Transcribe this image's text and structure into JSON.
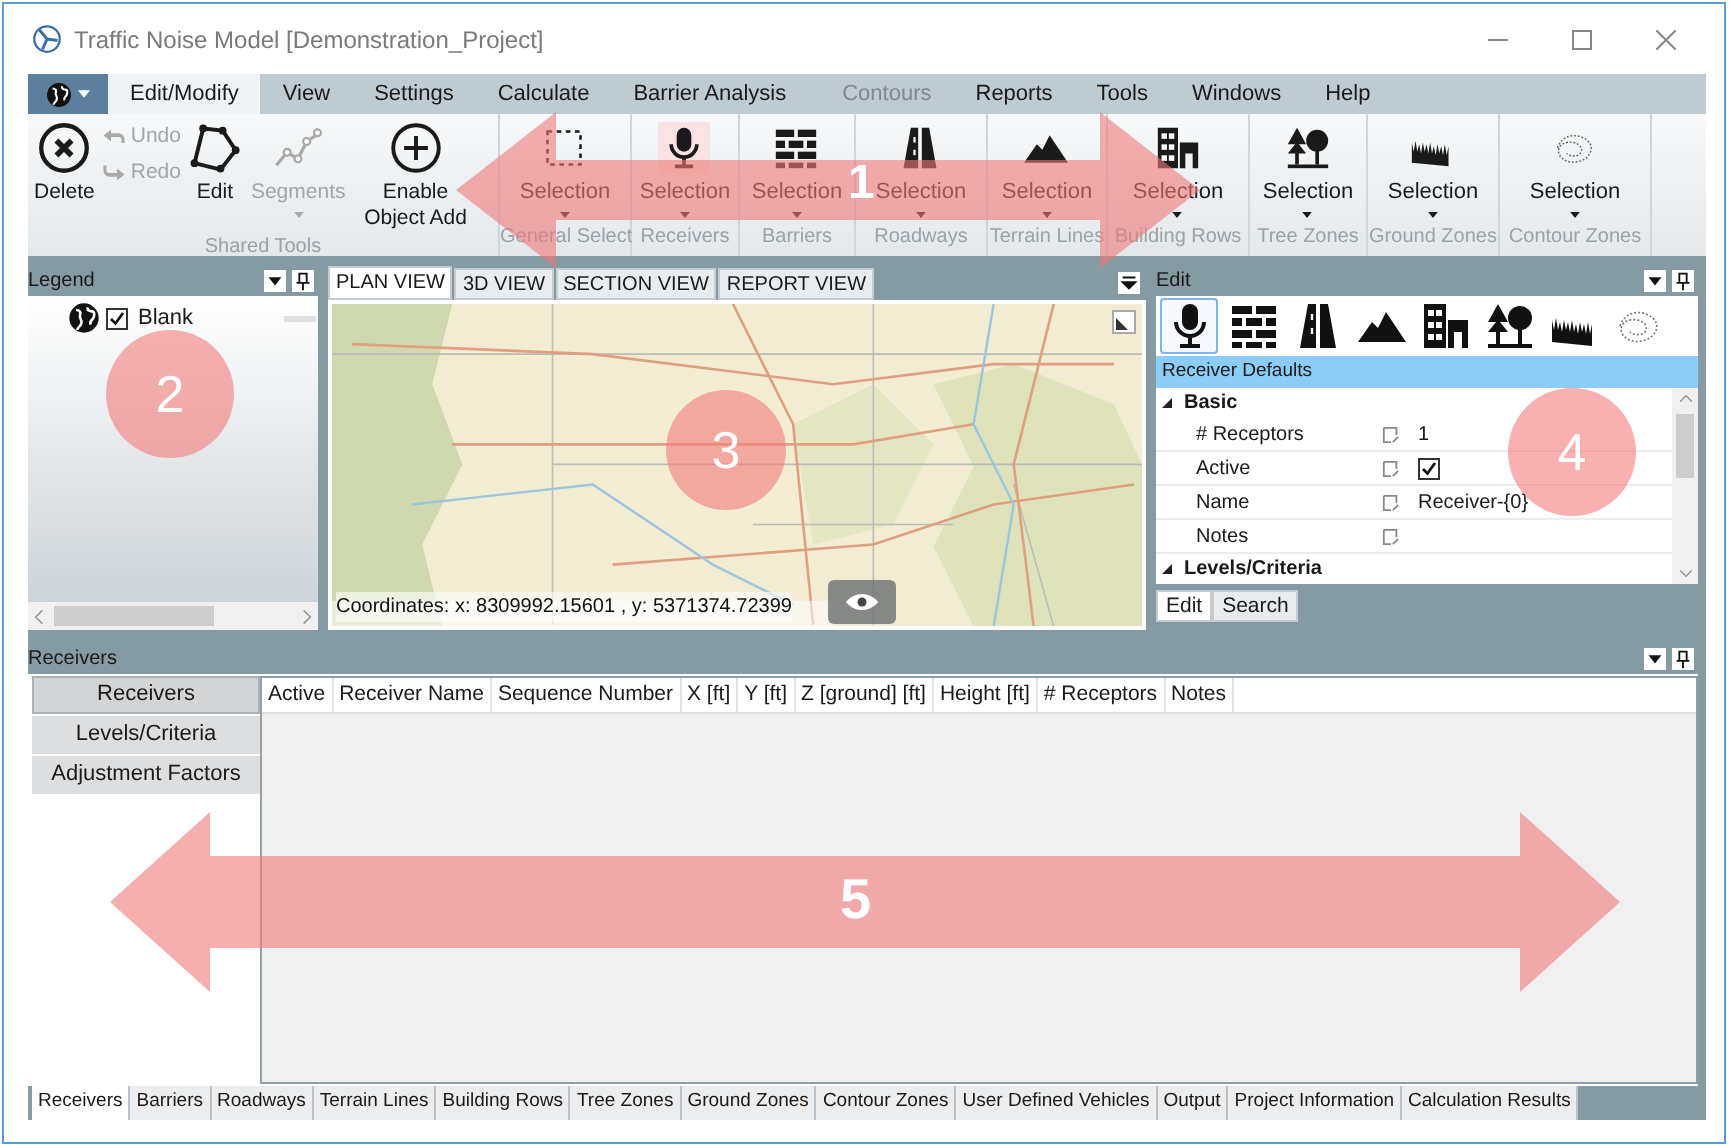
{
  "window": {
    "title": "Traffic Noise Model [Demonstration_Project]"
  },
  "menu": [
    {
      "label": "Edit/Modify",
      "selected": true,
      "disabled": false
    },
    {
      "label": "View",
      "selected": false,
      "disabled": false
    },
    {
      "label": "Settings",
      "selected": false,
      "disabled": false
    },
    {
      "label": "Calculate",
      "selected": false,
      "disabled": false
    },
    {
      "label": "Barrier Analysis",
      "selected": false,
      "disabled": false
    },
    {
      "label": "Contours",
      "selected": false,
      "disabled": true
    },
    {
      "label": "Reports",
      "selected": false,
      "disabled": false
    },
    {
      "label": "Tools",
      "selected": false,
      "disabled": false
    },
    {
      "label": "Windows",
      "selected": false,
      "disabled": false
    },
    {
      "label": "Help",
      "selected": false,
      "disabled": false
    }
  ],
  "shared_tools": {
    "label": "Shared Tools",
    "tools": [
      {
        "kind": "large",
        "label": "Delete",
        "disabled": false
      },
      {
        "kind": "small",
        "label": "Undo",
        "disabled": true
      },
      {
        "kind": "small",
        "label": "Redo",
        "disabled": true
      },
      {
        "kind": "large",
        "label": "Edit",
        "disabled": false
      },
      {
        "kind": "dropdown",
        "label": "Segments",
        "disabled": true
      },
      {
        "kind": "large",
        "label": "Enable Object Add",
        "disabled": false
      }
    ]
  },
  "select_groups": [
    {
      "label": "General Select",
      "tool": "Selection",
      "selected": false
    },
    {
      "label": "Receivers",
      "tool": "Selection",
      "selected": true
    },
    {
      "label": "Barriers",
      "tool": "Selection",
      "selected": false
    },
    {
      "label": "Roadways",
      "tool": "Selection",
      "selected": false
    },
    {
      "label": "Terrain Lines",
      "tool": "Selection",
      "selected": false
    },
    {
      "label": "Building Rows",
      "tool": "Selection",
      "selected": false
    },
    {
      "label": "Tree Zones",
      "tool": "Selection",
      "selected": false
    },
    {
      "label": "Ground Zones",
      "tool": "Selection",
      "selected": false
    },
    {
      "label": "Contour Zones",
      "tool": "Selection",
      "selected": false
    }
  ],
  "legend": {
    "title": "Legend",
    "layers": [
      {
        "label": "Blank",
        "checked": true
      }
    ]
  },
  "map": {
    "tabs": [
      {
        "label": "PLAN VIEW",
        "selected": true
      },
      {
        "label": "3D VIEW",
        "selected": false
      },
      {
        "label": "SECTION VIEW",
        "selected": false
      },
      {
        "label": "REPORT VIEW",
        "selected": false
      }
    ],
    "coordinates": "Coordinates: x: 8309992.15601 , y: 5371374.72399"
  },
  "edit_panel": {
    "title": "Edit",
    "object_types": [
      {
        "selected": true
      },
      {
        "selected": false
      },
      {
        "selected": false
      },
      {
        "selected": false
      },
      {
        "selected": false
      },
      {
        "selected": false
      },
      {
        "selected": false
      },
      {
        "selected": false
      }
    ],
    "section": "Receiver Defaults",
    "categories": [
      {
        "label": "Basic",
        "expanded": true,
        "properties": [
          {
            "kind": "text",
            "name": "# Receptors",
            "value": "1"
          },
          {
            "kind": "checkbox",
            "name": "Active",
            "checked": true
          },
          {
            "kind": "text",
            "name": "Name",
            "value": "Receiver-{0}"
          },
          {
            "kind": "text",
            "name": "Notes"
          }
        ]
      },
      {
        "label": "Levels/Criteria",
        "expanded": true
      }
    ],
    "tabs": [
      {
        "label": "Edit",
        "selected": true
      },
      {
        "label": "Search",
        "selected": false
      }
    ]
  },
  "receivers_panel": {
    "title": "Receivers",
    "nav": [
      {
        "label": "Receivers",
        "selected": true
      },
      {
        "label": "Levels/Criteria",
        "selected": false
      },
      {
        "label": "Adjustment Factors",
        "selected": false
      }
    ],
    "columns": [
      "Active",
      "Receiver Name",
      "Sequence Number",
      "X [ft]",
      "Y [ft]",
      "Z [ground] [ft]",
      "Height [ft]",
      "# Receptors",
      "Notes"
    ]
  },
  "bottom_tabs": [
    {
      "label": "Receivers",
      "selected": true
    },
    {
      "label": "Barriers",
      "selected": false
    },
    {
      "label": "Roadways",
      "selected": false
    },
    {
      "label": "Terrain Lines",
      "selected": false
    },
    {
      "label": "Building Rows",
      "selected": false
    },
    {
      "label": "Tree Zones",
      "selected": false
    },
    {
      "label": "Ground Zones",
      "selected": false
    },
    {
      "label": "Contour Zones",
      "selected": false
    },
    {
      "label": "User Defined Vehicles",
      "selected": false
    },
    {
      "label": "Output",
      "selected": false
    },
    {
      "label": "Project Information",
      "selected": false
    },
    {
      "label": "Calculation Results",
      "selected": false
    }
  ],
  "callouts": [
    {
      "kind": "arrow",
      "label": "1"
    },
    {
      "kind": "circle",
      "label": "2"
    },
    {
      "kind": "circle",
      "label": "3"
    },
    {
      "kind": "circle",
      "label": "4"
    },
    {
      "kind": "arrow",
      "label": "5"
    }
  ]
}
